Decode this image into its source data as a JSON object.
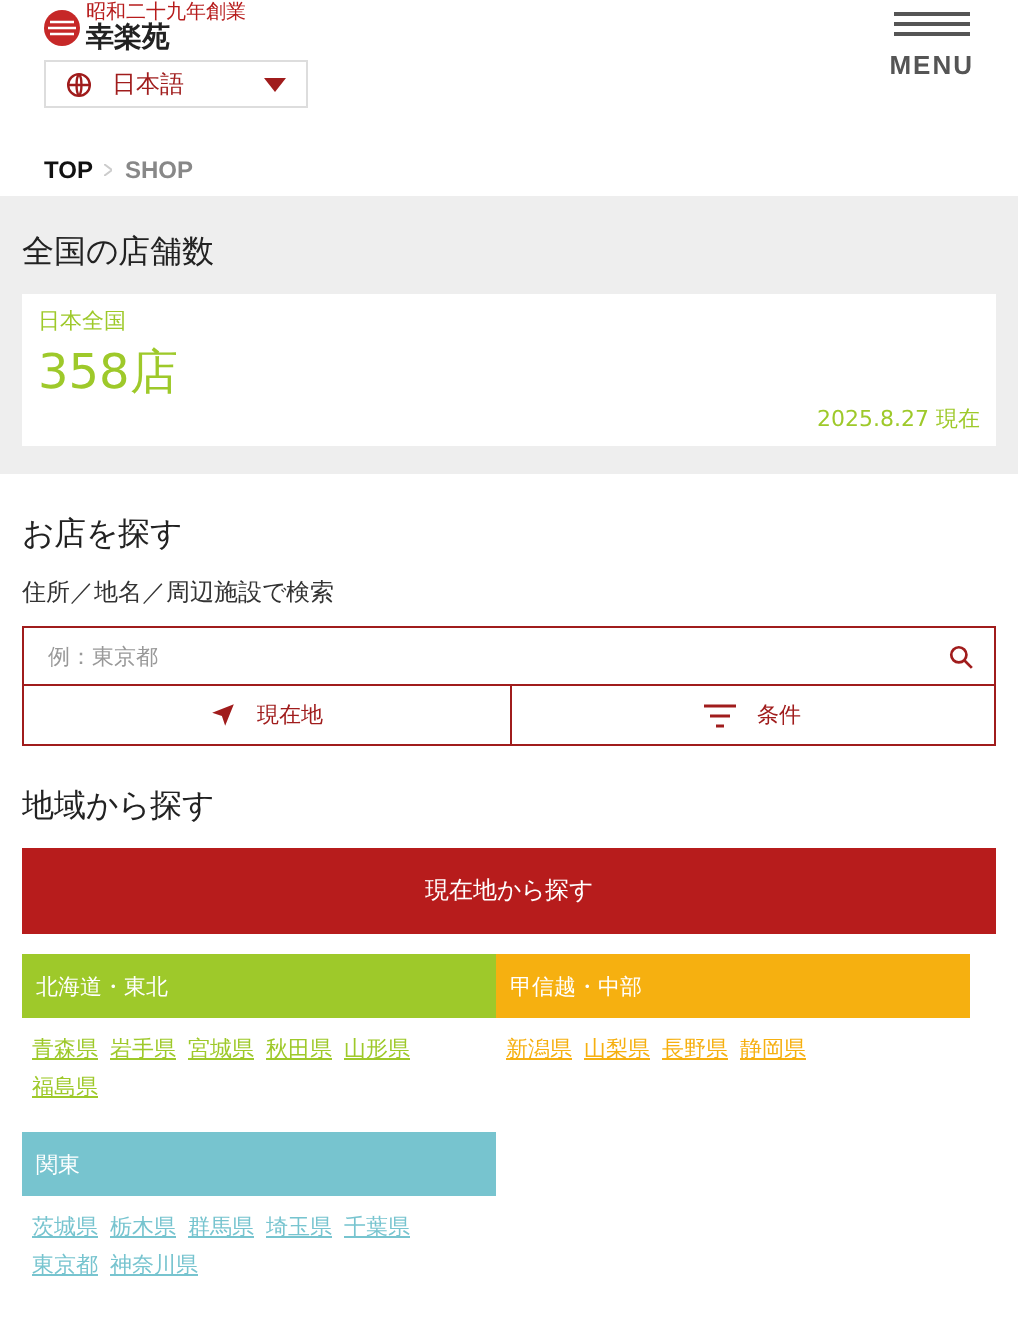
{
  "header": {
    "logo_tagline": "昭和二十九年創業",
    "logo_name": "幸楽苑",
    "language": "日本語",
    "menu_label": "MENU"
  },
  "breadcrumb": [
    "TOP",
    "SHOP"
  ],
  "store_count": {
    "title": "全国の店舗数",
    "area": "日本全国",
    "count": "358店",
    "as_of": "2025.8.27 現在"
  },
  "search": {
    "title": "お店を探す",
    "label": "住所／地名／周辺施設で検索",
    "placeholder": "例：東京都",
    "buttons": [
      {
        "kind": "location",
        "label": "現在地"
      },
      {
        "kind": "filter",
        "label": "条件"
      }
    ]
  },
  "regions": {
    "title": "地域から探す",
    "nearby_button": "現在地から探す",
    "groups": [
      {
        "name": "北海道・東北",
        "color": "#9ec92a",
        "prefectures": [
          "青森県",
          "岩手県",
          "宮城県",
          "秋田県",
          "山形県",
          "福島県"
        ]
      },
      {
        "name": "甲信越・中部",
        "color": "#f6b010",
        "prefectures": [
          "新潟県",
          "山梨県",
          "長野県",
          "静岡県"
        ]
      },
      {
        "name": "関東",
        "color": "#77c4cf",
        "prefectures": [
          "茨城県",
          "栃木県",
          "群馬県",
          "埼玉県",
          "千葉県",
          "東京都",
          "神奈川県"
        ]
      }
    ]
  }
}
